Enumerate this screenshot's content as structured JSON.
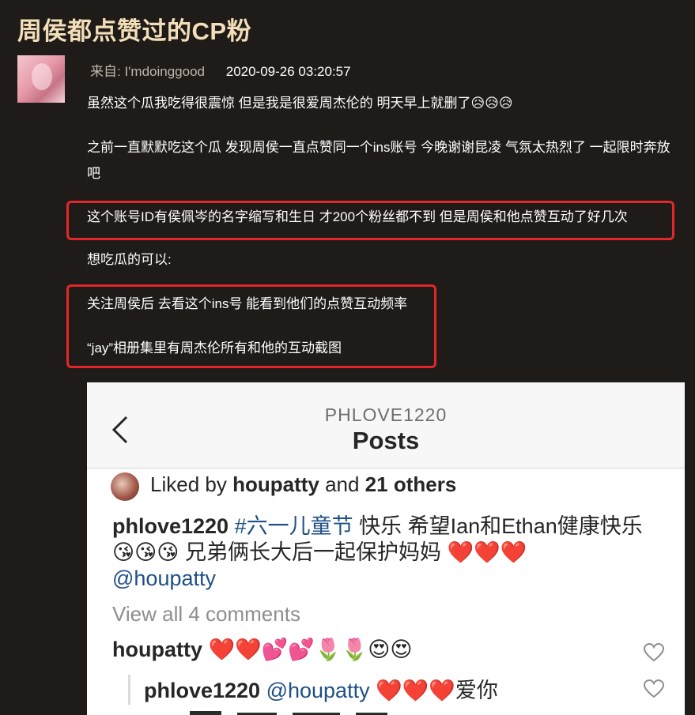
{
  "post": {
    "title": "周侯都点赞过的CP粉",
    "author": "来自: I'mdoinggood",
    "time": "2020-09-26 03:20:57",
    "paragraphs": [
      "虽然这个瓜我吃得很震惊 但是我是很爱周杰伦的 明天早上就删了😥😥😥",
      "之前一直默默吃这个瓜 发现周侯一直点赞同一个ins账号 今晚谢谢昆凌 气氛太热烈了 一起限时奔放吧",
      "这个账号ID有侯佩岑的名字缩写和生日 才200个粉丝都不到 但是周侯和他点赞互动了好几次",
      "想吃瓜的可以:",
      "关注周侯后 去看这个ins号 能看到他们的点赞互动频率",
      "“jay”相册集里有周杰伦所有和他的互动截图"
    ]
  },
  "instagram": {
    "account": "PHLOVE1220",
    "page_title": "Posts",
    "liked_prefix": "Liked by ",
    "liked_user": "houpatty",
    "liked_mid": " and ",
    "liked_others": "21 others",
    "caption_user": "phlove1220",
    "caption_tag": "#六一儿童节",
    "caption_text": " 快乐 希望Ian和Ethan健康快乐 😘😘😘 兄弟俩长大后一起保护妈妈 ❤️❤️❤️",
    "caption_mention": "@houpatty",
    "view_all": "View all 4 comments",
    "comment1_user": "houpatty",
    "comment1_text": " ❤️❤️💕💕🌷🌷😍😍",
    "comment2_user": "phlove1220",
    "comment2_mention": " @houpatty",
    "comment2_text": " ❤️❤️❤️爱你"
  },
  "icons": {
    "back": "chevron-left-icon",
    "like": "heart-outline-icon"
  },
  "colors": {
    "page_bg": "#1f1b18",
    "title": "#f2dfb9",
    "highlight_box": "#e3262a",
    "ig_link": "#1e4f85"
  }
}
